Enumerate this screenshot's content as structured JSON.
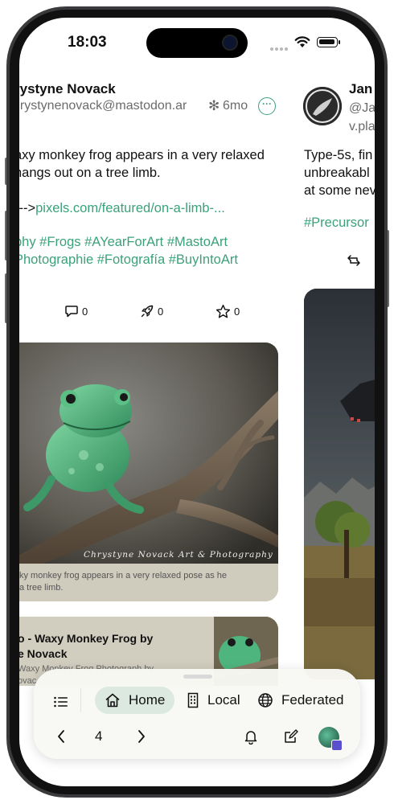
{
  "status": {
    "time": "18:03"
  },
  "post1": {
    "author_name": "rystyne Novack",
    "handle": "hrystynenovack@mastodon.ar",
    "age": "6mo",
    "body_lines": [
      "axy monkey frog appears in a very relaxed",
      "hangs out on a tree limb."
    ],
    "link_prefix": "--->",
    "link_text": "pixels.com/featured/on-a-limb-...",
    "tags_lines": [
      "phy #Frogs #AYearForArt #MastoArt",
      "Photographie #Fotografía #BuyIntoArt"
    ],
    "replies": "0",
    "boosts": "0",
    "favourites": "0",
    "image_watermark": "Chrystyne Novack Art & Photography",
    "image_alt_lines": [
      "ky monkey frog appears in a very relaxed pose as he",
      "a tree limb."
    ],
    "link_card": {
      "title_lines": [
        "o - Waxy Monkey Frog by",
        "e Novack"
      ],
      "desc_lines": [
        "Waxy Monkey Frog Photograph by",
        "ovac"
      ]
    }
  },
  "post2": {
    "author_name": "Jan",
    "handle_lines": [
      "@Ja",
      "v.pla"
    ],
    "body_lines": [
      "Type-5s, fin",
      "unbreakabl",
      "at some nev"
    ],
    "tag": "#Precursor"
  },
  "toolbar": {
    "tabs": [
      {
        "label": "Home",
        "active": true
      },
      {
        "label": "Local",
        "active": false
      },
      {
        "label": "Federated",
        "active": false
      }
    ],
    "page_number": "4"
  },
  "colors": {
    "accent": "#3aa27b",
    "active_tab_bg": "#dbe9e1"
  }
}
